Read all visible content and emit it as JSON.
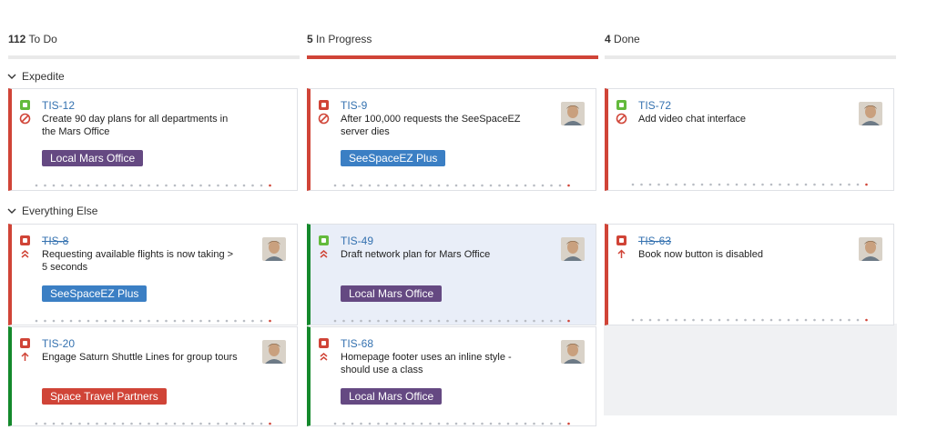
{
  "columns": [
    {
      "count": "112",
      "name": "To Do"
    },
    {
      "count": "5",
      "name": "In Progress"
    },
    {
      "count": "4",
      "name": "Done"
    }
  ],
  "swimlanes": [
    {
      "label": "Expedite"
    },
    {
      "label": "Everything Else"
    }
  ],
  "colors": {
    "story": "#63ba3c",
    "bug": "#d04437",
    "link": "#3572b0",
    "epic_purple": "#654982",
    "epic_blue": "#3b7fc4",
    "epic_red": "#d04437",
    "green_flag": "#14892c",
    "red_flag": "#d04437"
  },
  "cards": [
    {
      "key": "TIS-12",
      "summary": "Create 90 day plans for all departments in the Mars Office",
      "type_icon": "story-icon",
      "priority_icon": "blocker-icon",
      "epic": "Local Mars Office",
      "epic_color": "#654982",
      "avatar": false,
      "done": false,
      "flag": "red"
    },
    {
      "key": "TIS-9",
      "summary": "After 100,000 requests the SeeSpaceEZ server dies",
      "type_icon": "bug-icon",
      "priority_icon": "blocker-icon",
      "epic": "SeeSpaceEZ Plus",
      "epic_color": "#3b7fc4",
      "avatar": true,
      "done": false,
      "flag": "red"
    },
    {
      "key": "TIS-72",
      "summary": "Add video chat interface",
      "type_icon": "story-icon",
      "priority_icon": "blocker-icon",
      "epic": "",
      "avatar": true,
      "done": false,
      "flag": "red"
    },
    {
      "key": "TIS-8",
      "summary": "Requesting available flights is now taking > 5 seconds",
      "type_icon": "bug-icon",
      "priority_icon": "critical-icon",
      "epic": "SeeSpaceEZ Plus",
      "epic_color": "#3b7fc4",
      "avatar": true,
      "done": true,
      "flag": "red"
    },
    {
      "key": "TIS-49",
      "summary": "Draft network plan for Mars Office",
      "type_icon": "story-icon",
      "priority_icon": "critical-icon",
      "epic": "Local Mars Office",
      "epic_color": "#654982",
      "avatar": true,
      "done": false,
      "flag": "green"
    },
    {
      "key": "TIS-63",
      "summary": "Book now button is disabled",
      "type_icon": "bug-icon",
      "priority_icon": "major-icon",
      "epic": "",
      "avatar": true,
      "done": true,
      "flag": "red"
    },
    {
      "key": "TIS-20",
      "summary": "Engage Saturn Shuttle Lines for group tours",
      "type_icon": "bug-icon",
      "priority_icon": "major-icon",
      "epic": "Space Travel Partners",
      "epic_color": "#d04437",
      "avatar": true,
      "done": false,
      "flag": "green"
    },
    {
      "key": "TIS-68",
      "summary": "Homepage footer uses an inline style - should use a class",
      "type_icon": "bug-icon",
      "priority_icon": "critical-icon",
      "epic": "Local Mars Office",
      "epic_color": "#654982",
      "avatar": true,
      "done": false,
      "flag": "green"
    }
  ]
}
